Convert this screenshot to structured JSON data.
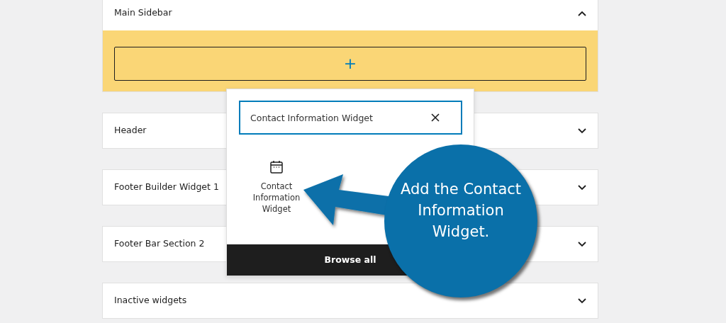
{
  "panels": [
    {
      "title": "Main Sidebar",
      "expanded": true,
      "add_button": "+"
    },
    {
      "title": "Header",
      "expanded": false
    },
    {
      "title": "Footer Builder Widget 1",
      "expanded": false
    },
    {
      "title": "Footer Bar Section 2",
      "expanded": false
    },
    {
      "title": "Inactive widgets",
      "expanded": false
    }
  ],
  "inserter": {
    "search": {
      "value": "Contact Information Widget"
    },
    "results": [
      {
        "label": "Contact Information Widget"
      }
    ],
    "browse_button": "Browse all"
  },
  "callout": {
    "text": "Add the Contact Information Widget."
  }
}
